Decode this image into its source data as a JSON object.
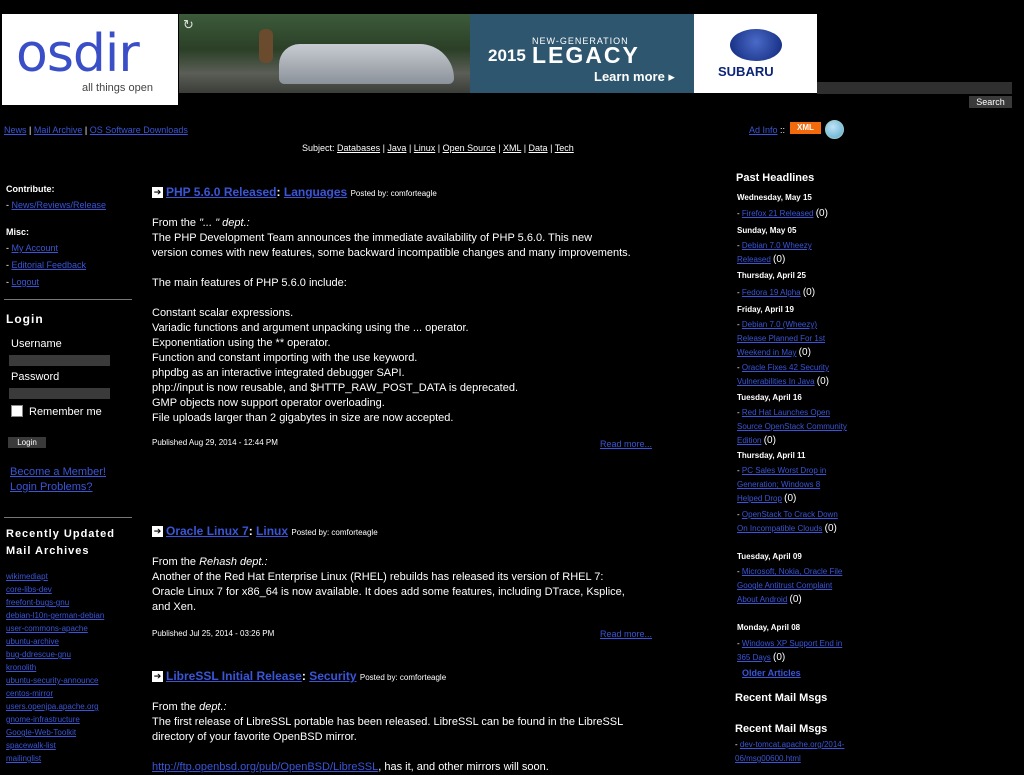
{
  "header": {
    "logo_text": "osdir",
    "logo_tagline": "all things open",
    "ad": {
      "reload_icon": "reload-icon",
      "new_generation": "NEW-GENERATION",
      "year": "2015",
      "model": "LEGACY",
      "cta": "Learn more ▸",
      "brand": "SUBARU"
    },
    "search_button": "Search"
  },
  "nav": {
    "links": [
      "News",
      "Mail Archive",
      "OS Software Downloads"
    ],
    "ad_info": "Ad Info",
    "separator": "::",
    "xml_badge": "XML"
  },
  "subjects": {
    "prefix": "Subject:",
    "items": [
      "Databases",
      "Java",
      "Linux",
      "Open Source",
      "XML",
      "Data",
      "Tech"
    ]
  },
  "left": {
    "contribute_heading": "Contribute:",
    "contribute_items": [
      "News/Reviews/Release"
    ],
    "misc_heading": "Misc:",
    "misc_items": [
      "My Account",
      "Editorial Feedback",
      "Logout"
    ],
    "login_heading": "Login",
    "username_label": "Username",
    "password_label": "Password",
    "remember_label": "Remember me",
    "login_button": "Login",
    "become_member": "Become a Member!",
    "login_problems": "Login Problems?",
    "recent_heading_1": "Recently Updated",
    "recent_heading_2": "Mail Archives",
    "archives": [
      "wikimediapt",
      "core-libs-dev",
      "freefont-bugs-gnu",
      "debian-l10n-german-debian",
      "user-commons-apache",
      "ubuntu-archive",
      "bug-ddrescue-gnu",
      "kronolith",
      "ubuntu-security-announce",
      "centos-mirror",
      "users.openjpa.apache.org",
      "gnome-infrastructure",
      "Google-Web-Toolkit",
      "spacewalk-list",
      "mailinglist"
    ]
  },
  "articles": [
    {
      "title": "PHP 5.6.0 Released",
      "category": "Languages",
      "posted_by": "Posted by: comforteagle",
      "dept_prefix": "From the",
      "dept": "\"... \" dept.:",
      "lines": [
        "The PHP Development Team announces the immediate availability of PHP 5.6.0. This new",
        "version comes with new features, some backward incompatible changes and many improvements.",
        "",
        "The main features of PHP 5.6.0 include:",
        "",
        "Constant scalar expressions.",
        "Variadic functions and argument unpacking using the ... operator.",
        "Exponentiation using the ** operator.",
        "Function and constant importing with the use keyword.",
        "phpdbg as an interactive integrated debugger SAPI.",
        "php://input is now reusable, and $HTTP_RAW_POST_DATA is deprecated.",
        "GMP objects now support operator overloading.",
        "File uploads larger than 2 gigabytes in size are now accepted."
      ],
      "published": "Published Aug 29, 2014 - 12:44 PM",
      "read_more": "Read more..."
    },
    {
      "title": "Oracle Linux 7",
      "category": "Linux",
      "posted_by": "Posted by: comforteagle",
      "dept_prefix": "From the",
      "dept": "Rehash dept.:",
      "lines": [
        "Another of the Red Hat Enterprise Linux (RHEL) rebuilds has released its version of RHEL 7:",
        "Oracle Linux 7 for x86_64 is now available. It does add some features, including DTrace, Ksplice,",
        "and Xen."
      ],
      "published": "Published Jul 25, 2014 - 03:26 PM",
      "read_more": "Read more..."
    },
    {
      "title": "LibreSSL Initial Release",
      "category": "Security",
      "posted_by": "Posted by: comforteagle",
      "dept_prefix": "From the",
      "dept": "dept.:",
      "lines": [
        "The first release of LibreSSL portable has been released. LibreSSL can be found in the LibreSSL",
        "directory of your favorite OpenBSD mirror."
      ],
      "tail_link": "http://ftp.openbsd.org/pub/OpenBSD/LibreSSL",
      "tail_text": ", has it, and other mirrors will soon."
    }
  ],
  "right": {
    "past_headlines": "Past Headlines",
    "days": [
      {
        "day": "Wednesday, May 15",
        "items": [
          {
            "text": "Firefox 21 Released",
            "count": "(0)"
          }
        ]
      },
      {
        "day": "Sunday, May 05",
        "items": [
          {
            "text": "Debian 7.0 Wheezy Released",
            "count": "(0)"
          }
        ]
      },
      {
        "day": "Thursday, April 25",
        "items": [
          {
            "text": "Fedora 19 Alpha",
            "count": "(0)"
          }
        ]
      },
      {
        "day": "Friday, April 19",
        "items": [
          {
            "text": "Debian 7.0 (Wheezy) Release Planned For 1st Weekend in May",
            "count": "(0)"
          },
          {
            "text": "Oracle Fixes 42 Security Vulnerabilities In Java",
            "count": "(0)"
          }
        ]
      },
      {
        "day": "Tuesday, April 16",
        "items": [
          {
            "text": "Red Hat Launches Open Source OpenStack Community Edition",
            "count": "(0)"
          }
        ]
      },
      {
        "day": "Thursday, April 11",
        "items": [
          {
            "text": "PC Sales Worst Drop in Generation; Windows 8 Helped Drop",
            "count": "(0)"
          },
          {
            "text": "OpenStack To Crack Down On Incompatible Clouds",
            "count": "(0)"
          }
        ]
      },
      {
        "day": "Tuesday, April 09",
        "items": [
          {
            "text": "Microsoft, Nokia, Oracle File Google Antitrust Complaint About Android",
            "count": "(0)"
          }
        ]
      },
      {
        "day": "Monday, April 08",
        "items": [
          {
            "text": "Windows XP Support End in 365 Days",
            "count": "(0)"
          }
        ]
      }
    ],
    "older_articles": "Older Articles",
    "recent_mail_1": "Recent Mail Msgs",
    "recent_mail_2": "Recent Mail Msgs",
    "recent_mail_items": [
      "dev-tomcat.apache.org/2014-06/msg00600.html"
    ]
  }
}
